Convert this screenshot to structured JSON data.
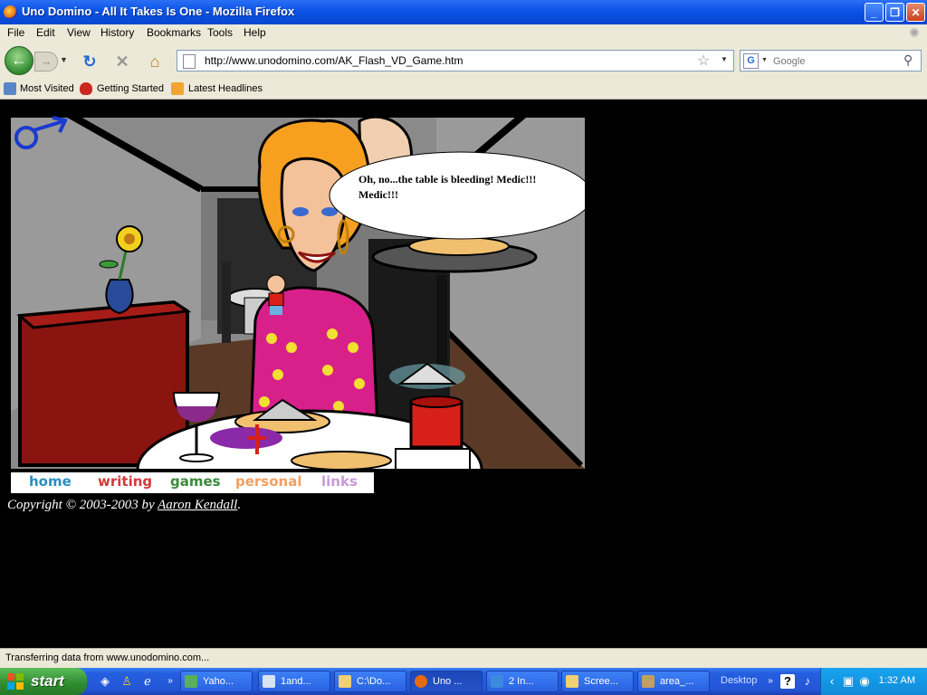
{
  "window": {
    "title": "Uno Domino - All It Takes Is One - Mozilla Firefox"
  },
  "menu": [
    "File",
    "Edit",
    "View",
    "History",
    "Bookmarks",
    "Tools",
    "Help"
  ],
  "address": {
    "url": "http://www.unodomino.com/AK_Flash_VD_Game.htm"
  },
  "search": {
    "placeholder": "Google"
  },
  "bookmarks": [
    {
      "label": "Most Visited",
      "icon": "most-visited-icon"
    },
    {
      "label": "Getting Started",
      "icon": "getting-started-icon"
    },
    {
      "label": "Latest Headlines",
      "icon": "rss-icon"
    }
  ],
  "scene": {
    "speech": "Oh, no...the table is bleeding!  Medic!!! Medic!!!"
  },
  "site_nav": [
    {
      "label": "home",
      "color": "#2a8fc0"
    },
    {
      "label": "writing",
      "color": "#d23a3a"
    },
    {
      "label": "games",
      "color": "#3a8a3a"
    },
    {
      "label": "personal",
      "color": "#f0a060"
    },
    {
      "label": "links",
      "color": "#c89ad8"
    }
  ],
  "footer": {
    "copyright_prefix": "Copyright © 2003-2003 by ",
    "author": "Aaron Kendall",
    "suffix": "."
  },
  "status": {
    "text": "Transferring data from www.unodomino.com..."
  },
  "taskbar": {
    "start_label": "start",
    "tasks": [
      {
        "label": "Yaho...",
        "color": "#5ab05a"
      },
      {
        "label": "1and...",
        "color": "#d8e4f4"
      },
      {
        "label": "C:\\Do...",
        "color": "#f0d070"
      },
      {
        "label": "Uno ...",
        "color": "#e56a10"
      },
      {
        "label": "2 In...",
        "color": "#3a8ae0"
      },
      {
        "label": "Scree...",
        "color": "#f0d070"
      },
      {
        "label": "area_...",
        "color": "#c0a060"
      }
    ],
    "desktop_label": "Desktop",
    "clock": "1:32 AM"
  }
}
